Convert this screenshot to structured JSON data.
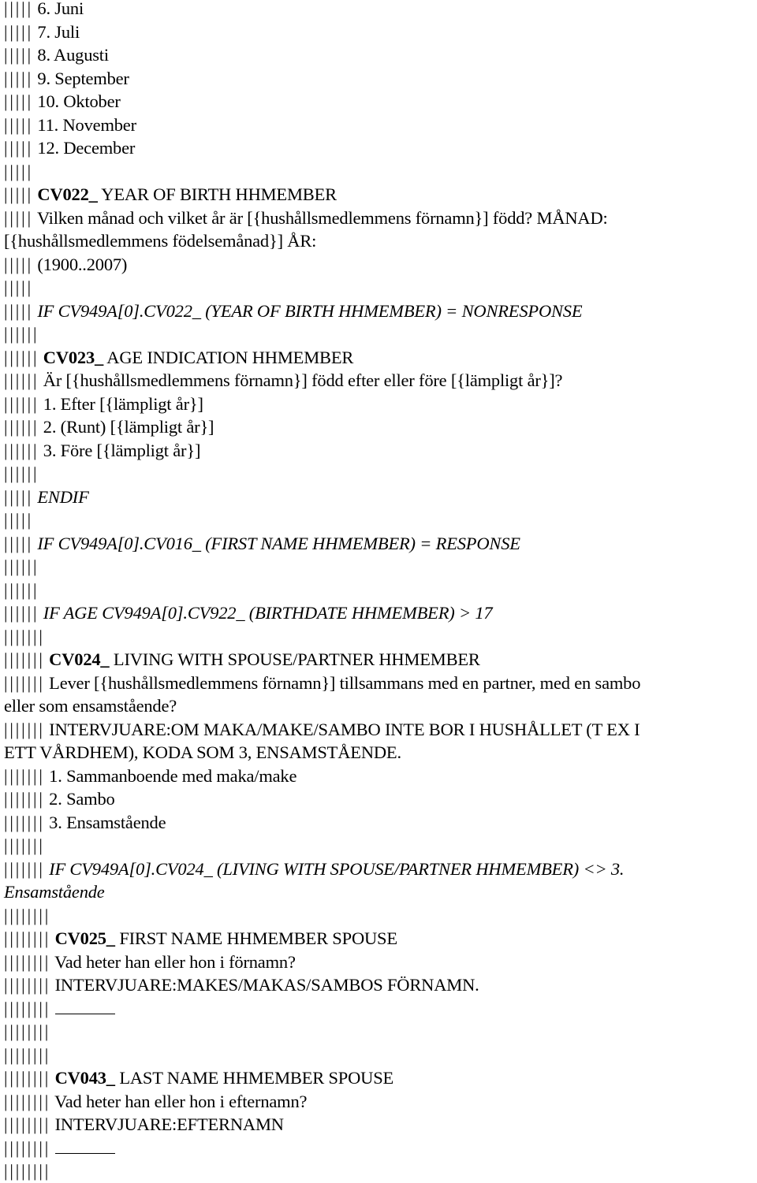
{
  "document": {
    "language": "sv",
    "lines": [
      {
        "depth": 5,
        "text": "6. Juni"
      },
      {
        "depth": 5,
        "text": "7. Juli"
      },
      {
        "depth": 5,
        "text": "8. Augusti"
      },
      {
        "depth": 5,
        "text": "9. September"
      },
      {
        "depth": 5,
        "text": "10. Oktober"
      },
      {
        "depth": 5,
        "text": "11. November"
      },
      {
        "depth": 5,
        "text": "12. December"
      },
      {
        "depth": 5,
        "text": ""
      },
      {
        "depth": 5,
        "code": "CV022_",
        "text": "YEAR OF BIRTH HHMEMBER",
        "kind": "question-code"
      },
      {
        "depth": 5,
        "text": "Vilken månad och vilket år är [{hushållsmedlemmens förnamn}] född? MÅNAD:"
      },
      {
        "depth": 0,
        "text": "[{hushållsmedlemmens födelsemånad}] ÅR:"
      },
      {
        "depth": 5,
        "text": "(1900..2007)"
      },
      {
        "depth": 5,
        "text": ""
      },
      {
        "depth": 5,
        "text": "IF CV949A[0].CV022_ (YEAR OF BIRTH HHMEMBER) = NONRESPONSE",
        "kind": "condition"
      },
      {
        "depth": 6,
        "text": ""
      },
      {
        "depth": 6,
        "code": "CV023_",
        "text": "AGE INDICATION HHMEMBER",
        "kind": "question-code"
      },
      {
        "depth": 6,
        "text": "Är [{hushållsmedlemmens förnamn}] född efter eller före [{lämpligt år}]?"
      },
      {
        "depth": 6,
        "text": "1. Efter [{lämpligt år}]"
      },
      {
        "depth": 6,
        "text": "2. (Runt) [{lämpligt år}]"
      },
      {
        "depth": 6,
        "text": "3. Före [{lämpligt år}]"
      },
      {
        "depth": 6,
        "text": ""
      },
      {
        "depth": 5,
        "text": "ENDIF",
        "kind": "condition"
      },
      {
        "depth": 5,
        "text": ""
      },
      {
        "depth": 5,
        "text": "IF CV949A[0].CV016_ (FIRST NAME HHMEMBER) = RESPONSE",
        "kind": "condition"
      },
      {
        "depth": 6,
        "text": ""
      },
      {
        "depth": 6,
        "text": ""
      },
      {
        "depth": 6,
        "text": "IF AGE CV949A[0].CV922_ (BIRTHDATE HHMEMBER) > 17",
        "kind": "condition"
      },
      {
        "depth": 7,
        "text": ""
      },
      {
        "depth": 7,
        "code": "CV024_",
        "text": "LIVING WITH SPOUSE/PARTNER HHMEMBER",
        "kind": "question-code"
      },
      {
        "depth": 7,
        "text": "Lever [{hushållsmedlemmens förnamn}] tillsammans med en partner, med en sambo"
      },
      {
        "depth": 0,
        "text": "eller som ensamstående?"
      },
      {
        "depth": 7,
        "text": "INTERVJUARE:OM MAKA/MAKE/SAMBO INTE BOR I HUSHÅLLET (T EX I"
      },
      {
        "depth": 0,
        "text": "ETT VÅRDHEM), KODA SOM 3, ENSAMSTÅENDE."
      },
      {
        "depth": 7,
        "text": "1. Sammanboende med maka/make"
      },
      {
        "depth": 7,
        "text": "2. Sambo"
      },
      {
        "depth": 7,
        "text": "3. Ensamstående"
      },
      {
        "depth": 7,
        "text": ""
      },
      {
        "depth": 7,
        "text": "IF CV949A[0].CV024_ (LIVING WITH SPOUSE/PARTNER HHMEMBER) <> 3.",
        "kind": "condition"
      },
      {
        "depth": 0,
        "text": "Ensamstående",
        "kind": "condition"
      },
      {
        "depth": 8,
        "text": ""
      },
      {
        "depth": 8,
        "code": "CV025_",
        "text": "FIRST NAME HHMEMBER SPOUSE",
        "kind": "question-code"
      },
      {
        "depth": 8,
        "text": "Vad heter han eller hon i förnamn?"
      },
      {
        "depth": 8,
        "text": "INTERVJUARE:MAKES/MAKAS/SAMBOS FÖRNAMN."
      },
      {
        "depth": 8,
        "text": "",
        "kind": "blank-field"
      },
      {
        "depth": 8,
        "text": ""
      },
      {
        "depth": 8,
        "text": ""
      },
      {
        "depth": 8,
        "code": "CV043_",
        "text": "LAST NAME HHMEMBER SPOUSE",
        "kind": "question-code"
      },
      {
        "depth": 8,
        "text": "Vad heter han eller hon i efternamn?"
      },
      {
        "depth": 8,
        "text": "INTERVJUARE:EFTERNAMN"
      },
      {
        "depth": 8,
        "text": "",
        "kind": "blank-field"
      },
      {
        "depth": 8,
        "text": ""
      }
    ]
  }
}
